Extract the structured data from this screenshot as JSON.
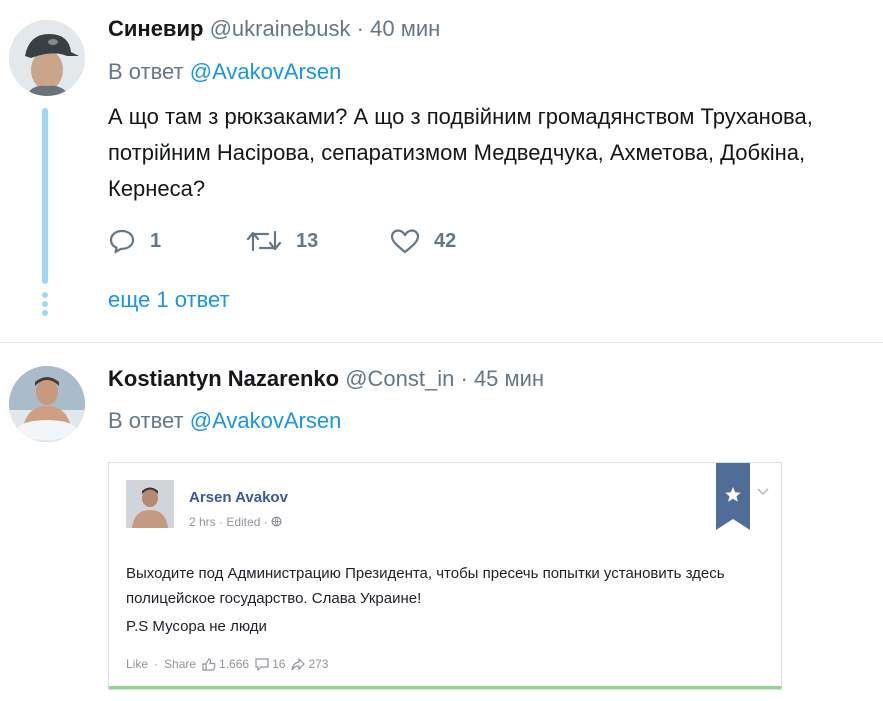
{
  "tweets": [
    {
      "name": "Синевир",
      "handle": "@ukrainebusk",
      "separator": "·",
      "time": "40 мин",
      "reply_prefix": "В ответ",
      "reply_to": "@AvakovArsen",
      "text": "А що там з рюкзаками? А що з подвійним громадянством Труханова,\nпотрійним Насірова, сепаратизмом Медведчука, Ахметова, Добкіна,\nКернеса?",
      "actions": {
        "replies": "1",
        "retweets": "13",
        "likes": "42"
      },
      "more_replies": "еще 1 ответ"
    },
    {
      "name": "Kostiantyn Nazarenko",
      "handle": "@Const_in",
      "separator": "·",
      "time": "45 мин",
      "reply_prefix": "В ответ",
      "reply_to": "@AvakovArsen",
      "embed": {
        "author": "Arsen Avakov",
        "meta": "2 hrs · Edited · ",
        "text": "Выходите под Администрацию Президента, чтобы пресечь попытки установить здесь полицейское государство. Слава Украине!",
        "ps": "P.S Мусора не люди",
        "like": "Like",
        "dot": "·",
        "share": "Share",
        "likes_count": "1.666",
        "comments_count": "16",
        "shares_count": "273"
      }
    }
  ],
  "colors": {
    "link": "#1b95e0",
    "muted": "#657786",
    "thread": "#9fd6f5",
    "fb_blue": "#3b5998"
  },
  "icons": [
    "reply-icon",
    "retweet-icon",
    "like-icon",
    "globe-icon",
    "bookmark-icon",
    "chevron-down-icon"
  ]
}
